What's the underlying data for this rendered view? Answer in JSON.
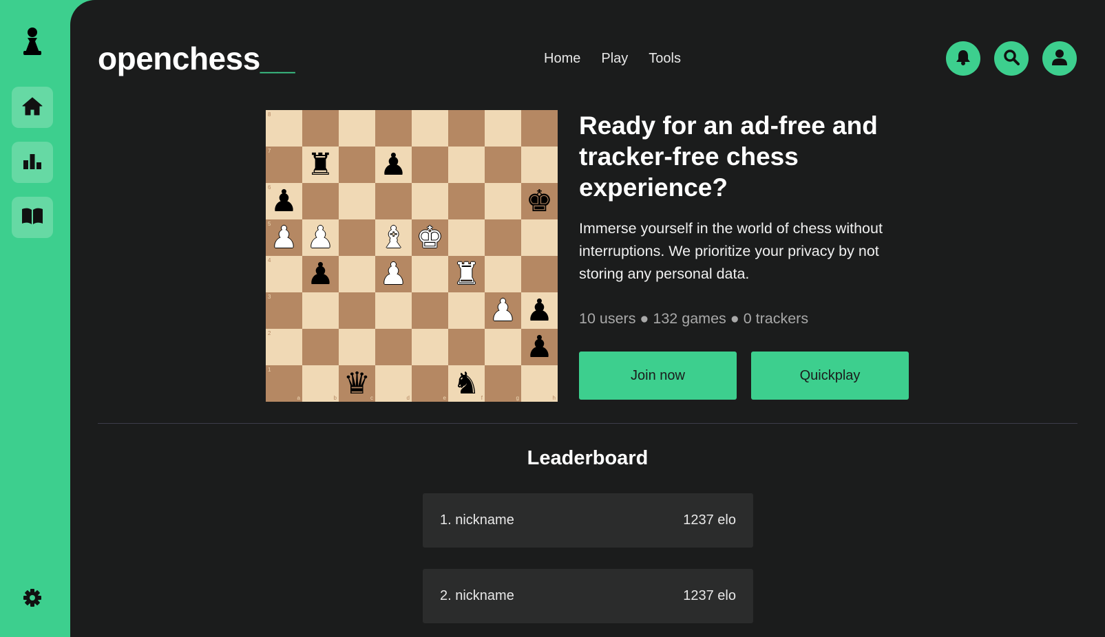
{
  "app": {
    "brand": "openchess",
    "brand_suffix": "__"
  },
  "sidebar": {
    "logo_icon": "pawn-icon",
    "items": [
      {
        "icon": "home-icon"
      },
      {
        "icon": "bar-chart-icon"
      },
      {
        "icon": "book-icon"
      }
    ],
    "settings_icon": "gear-icon"
  },
  "nav": {
    "items": [
      "Home",
      "Play",
      "Tools"
    ]
  },
  "header_icons": [
    "bell-icon",
    "search-icon",
    "user-icon"
  ],
  "board": {
    "ranks": [
      "8",
      "7",
      "6",
      "5",
      "4",
      "3",
      "2",
      "1"
    ],
    "files": [
      "a",
      "b",
      "c",
      "d",
      "e",
      "f",
      "g",
      "h"
    ],
    "position": [
      [
        "",
        "",
        "",
        "",
        "",
        "",
        "",
        ""
      ],
      [
        "",
        "r",
        "",
        "p",
        "",
        "",
        "",
        ""
      ],
      [
        "p",
        "",
        "",
        "",
        "",
        "",
        "",
        "k"
      ],
      [
        "P",
        "P",
        "",
        "B",
        "K",
        "",
        "",
        ""
      ],
      [
        "",
        "p",
        "",
        "P",
        "",
        "R",
        "",
        ""
      ],
      [
        "",
        "",
        "",
        "",
        "",
        "",
        "P",
        "p"
      ],
      [
        "",
        "",
        "",
        "",
        "",
        "",
        "",
        "p"
      ],
      [
        "",
        "",
        "q",
        "",
        "",
        "n",
        "",
        ""
      ]
    ]
  },
  "hero": {
    "title": "Ready for an ad-free and tracker-free chess experience?",
    "description": "Immerse yourself in the world of chess without interruptions. We prioritize your privacy by not storing any personal data.",
    "stats": "10 users ● 132 games ● 0 trackers",
    "join_label": "Join now",
    "quickplay_label": "Quickplay"
  },
  "leaderboard": {
    "title": "Leaderboard",
    "rows": [
      {
        "name": "1. nickname",
        "score": "1237 elo"
      },
      {
        "name": "2. nickname",
        "score": "1237 elo"
      }
    ]
  },
  "colors": {
    "accent": "#3dcf8e",
    "background": "#1b1c1c",
    "board_light": "#f0d9b5",
    "board_dark": "#b58863"
  }
}
